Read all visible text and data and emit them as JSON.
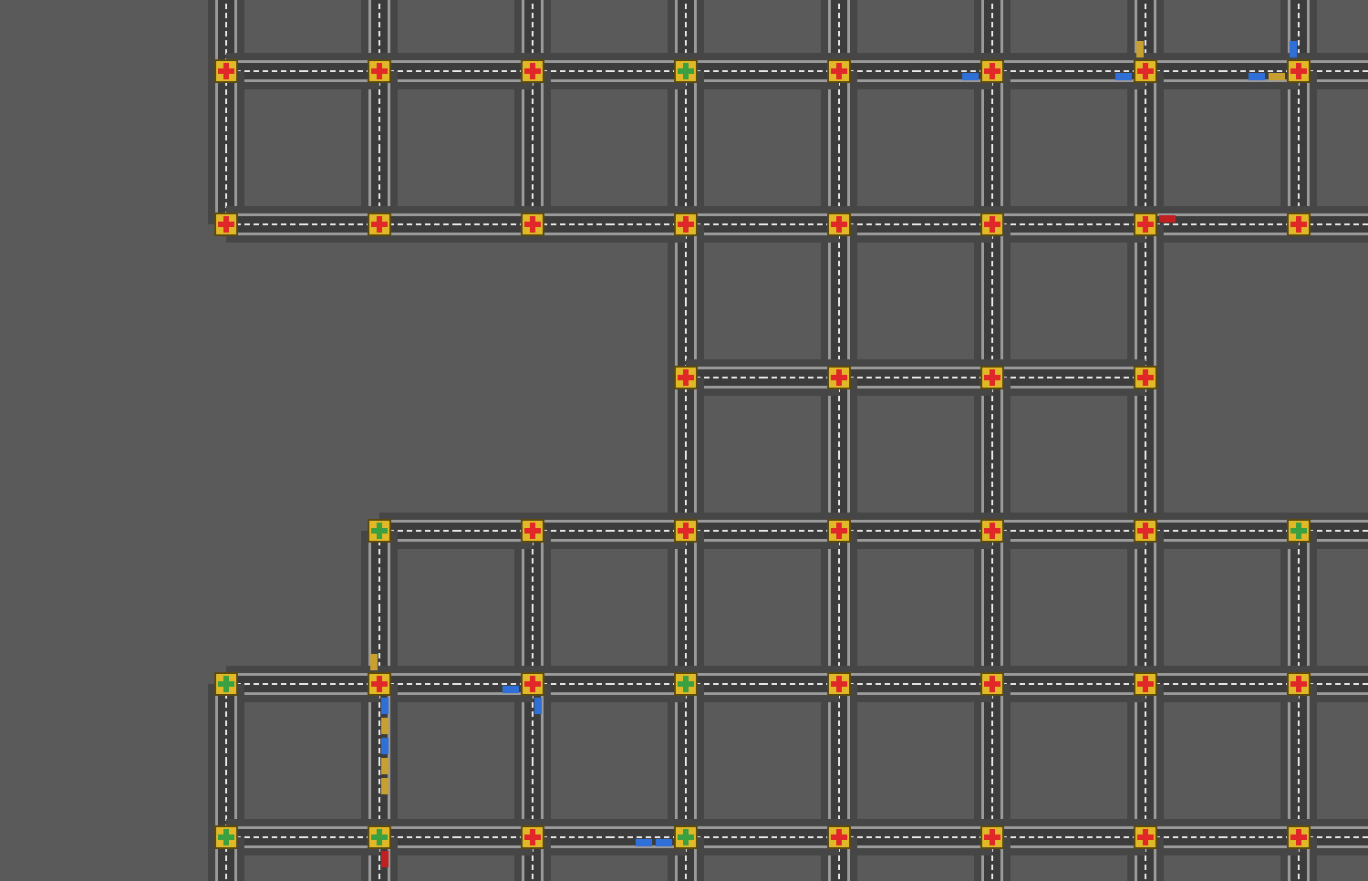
{
  "map": {
    "grid": [
      [
        {
          "kind": "junction",
          "green": false,
          "north": true,
          "east": true,
          "south": true
        },
        {
          "kind": "junction",
          "green": false,
          "north": true,
          "east": true,
          "south": true,
          "west": true
        },
        {
          "kind": "junction",
          "green": false,
          "north": true,
          "east": true,
          "south": true,
          "west": true
        },
        {
          "kind": "junction",
          "green": true,
          "north": true,
          "east": true,
          "south": true,
          "west": true
        },
        {
          "kind": "junction",
          "green": false,
          "north": true,
          "east": true,
          "south": true,
          "west": true
        },
        {
          "kind": "junction",
          "green": false,
          "north": true,
          "east": true,
          "south": true,
          "west": true,
          "cars": {
            "west": [
              {
                "color": "#2f6fd8"
              }
            ]
          }
        },
        {
          "kind": "junction",
          "green": false,
          "north": true,
          "east": true,
          "south": true,
          "west": true,
          "cars": {
            "west": [
              {
                "color": "#2f6fd8"
              }
            ],
            "north": [
              {
                "color": "#c8a030"
              }
            ]
          }
        },
        {
          "kind": "junction",
          "green": false,
          "north": true,
          "east": true,
          "south": true,
          "west": true,
          "cars": {
            "west": [
              {
                "color": "#c8a030"
              },
              {
                "color": "#2f6fd8"
              }
            ],
            "north": [
              {
                "color": "#2f6fd8"
              }
            ]
          }
        }
      ],
      [
        {
          "kind": "junction",
          "green": false,
          "north": true,
          "east": true
        },
        {
          "kind": "junction",
          "green": false,
          "north": true,
          "east": true,
          "west": true
        },
        {
          "kind": "junction",
          "green": false,
          "north": true,
          "east": true,
          "west": true
        },
        {
          "kind": "junction",
          "green": false,
          "north": true,
          "east": true,
          "south": true,
          "west": true
        },
        {
          "kind": "junction",
          "green": false,
          "north": true,
          "east": true,
          "south": true,
          "west": true
        },
        {
          "kind": "junction",
          "green": false,
          "north": true,
          "east": true,
          "south": true,
          "west": true
        },
        {
          "kind": "junction",
          "green": false,
          "north": true,
          "east": true,
          "south": true,
          "west": true,
          "cars": {
            "east": [
              {
                "color": "#c02020"
              }
            ]
          }
        },
        {
          "kind": "junction",
          "green": false,
          "north": true,
          "east": true,
          "west": true
        }
      ],
      [
        {
          "kind": "vacant"
        },
        {
          "kind": "vacant"
        },
        {
          "kind": "vacant"
        },
        {
          "kind": "junction",
          "green": false,
          "north": true,
          "east": true,
          "south": true
        },
        {
          "kind": "junction",
          "green": false,
          "north": true,
          "east": true,
          "south": true,
          "west": true
        },
        {
          "kind": "junction",
          "green": false,
          "north": true,
          "east": true,
          "south": true,
          "west": true
        },
        {
          "kind": "junction",
          "green": false,
          "north": true,
          "south": true,
          "west": true
        },
        {
          "kind": "vacant"
        }
      ],
      [
        {
          "kind": "vacant"
        },
        {
          "kind": "junction",
          "green": true,
          "east": true,
          "south": true
        },
        {
          "kind": "junction",
          "green": false,
          "east": true,
          "south": true,
          "west": true
        },
        {
          "kind": "junction",
          "green": false,
          "north": true,
          "east": true,
          "south": true,
          "west": true
        },
        {
          "kind": "junction",
          "green": false,
          "north": true,
          "east": true,
          "south": true,
          "west": true
        },
        {
          "kind": "junction",
          "green": false,
          "north": true,
          "east": true,
          "south": true,
          "west": true
        },
        {
          "kind": "junction",
          "green": false,
          "north": true,
          "east": true,
          "south": true,
          "west": true
        },
        {
          "kind": "junction",
          "green": true,
          "east": true,
          "south": true,
          "west": true
        }
      ],
      [
        {
          "kind": "junction",
          "green": true,
          "east": true,
          "south": true
        },
        {
          "kind": "junction",
          "green": false,
          "north": true,
          "east": true,
          "south": true,
          "west": true,
          "cars": {
            "north": [
              {
                "color": "#c8a030"
              }
            ],
            "south": [
              {
                "color": "#2f6fd8"
              },
              {
                "color": "#c8a030"
              },
              {
                "color": "#2f6fd8"
              },
              {
                "color": "#c8a030"
              },
              {
                "color": "#c8a030"
              }
            ]
          }
        },
        {
          "kind": "junction",
          "green": false,
          "north": true,
          "east": true,
          "south": true,
          "west": true,
          "cars": {
            "west": [
              {
                "color": "#2f6fd8"
              }
            ],
            "south": [
              {
                "color": "#2f6fd8"
              }
            ]
          }
        },
        {
          "kind": "junction",
          "green": true,
          "north": true,
          "east": true,
          "south": true,
          "west": true
        },
        {
          "kind": "junction",
          "green": false,
          "north": true,
          "east": true,
          "south": true,
          "west": true
        },
        {
          "kind": "junction",
          "green": false,
          "north": true,
          "east": true,
          "south": true,
          "west": true
        },
        {
          "kind": "junction",
          "green": false,
          "north": true,
          "east": true,
          "south": true,
          "west": true
        },
        {
          "kind": "junction",
          "green": false,
          "north": true,
          "east": true,
          "south": true,
          "west": true
        }
      ],
      [
        {
          "kind": "junction",
          "green": true,
          "north": true,
          "east": true,
          "south": true
        },
        {
          "kind": "junction",
          "green": true,
          "north": true,
          "east": true,
          "south": true,
          "west": true,
          "cars": {
            "south": [
              {
                "color": "#c02020"
              }
            ]
          }
        },
        {
          "kind": "junction",
          "green": false,
          "north": true,
          "east": true,
          "south": true,
          "west": true
        },
        {
          "kind": "junction",
          "green": true,
          "north": true,
          "east": true,
          "south": true,
          "west": true,
          "cars": {
            "west": [
              {
                "color": "#2f6fd8"
              },
              {
                "color": "#2f6fd8"
              }
            ]
          }
        },
        {
          "kind": "junction",
          "green": false,
          "north": true,
          "east": true,
          "south": true,
          "west": true
        },
        {
          "kind": "junction",
          "green": false,
          "north": true,
          "east": true,
          "south": true,
          "west": true
        },
        {
          "kind": "junction",
          "green": false,
          "north": true,
          "east": true,
          "south": true,
          "west": true
        },
        {
          "kind": "junction",
          "green": false,
          "north": true,
          "east": true,
          "south": true,
          "west": true
        }
      ]
    ]
  }
}
